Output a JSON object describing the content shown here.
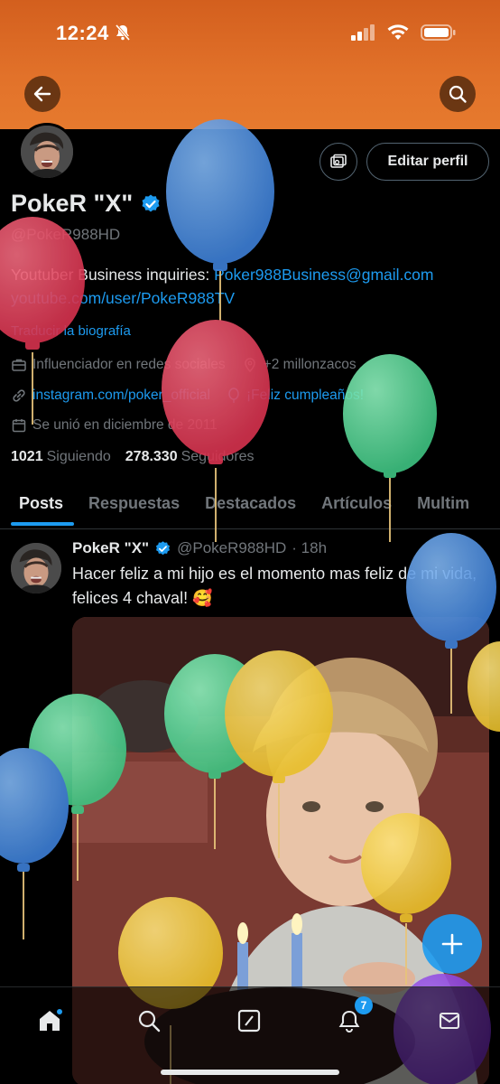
{
  "status_bar": {
    "time": "12:24",
    "bell_icon": "bell-slash-icon",
    "signal_icon": "cellular-signal-icon",
    "wifi_icon": "wifi-icon",
    "battery_icon": "battery-icon"
  },
  "header": {
    "back_icon": "arrow-left-icon",
    "search_icon": "search-icon",
    "banner_color": "#e2722a"
  },
  "profile": {
    "name": "PokeR \"X\"",
    "verified_icon": "verified-badge-icon",
    "handle": "@PokeR988HD",
    "edit_label": "Editar perfil",
    "bio_text": "Youtuber Business inquiries: ",
    "bio_email": "Poker988Business@gmail.com",
    "bio_url": "youtube.com/user/PokeR988TV",
    "translate": "Traducir la biografía",
    "category": "Influenciador en redes sociales",
    "location": "+2 millonzacos",
    "website": "instagram.com/poker_official",
    "birthday": "¡Feliz cumpleaños!",
    "joined": "Se unió en diciembre de 2011",
    "following_count": "1021",
    "following_label": "Siguiendo",
    "followers_count": "278.330",
    "followers_label": "Seguidores"
  },
  "tabs": [
    {
      "label": "Posts"
    },
    {
      "label": "Respuestas"
    },
    {
      "label": "Destacados"
    },
    {
      "label": "Artículos"
    },
    {
      "label": "Multim"
    }
  ],
  "tweet": {
    "name": "PokeR \"X\"",
    "handle": "@PokeR988HD",
    "time": "· 18h",
    "text": "Hacer feliz a mi hijo es el momento mas feliz de mi vida, felices 4 chaval! 🥰"
  },
  "bottom_nav": {
    "home_icon": "home-icon",
    "search_icon": "search-icon",
    "grok_icon": "grok-icon",
    "notifications_icon": "bell-icon",
    "notifications_badge": "7",
    "messages_icon": "mail-icon",
    "compose_icon": "plus-icon"
  },
  "colors": {
    "accent": "#1d9bf0",
    "background": "#000000",
    "text": "#e7e9ea",
    "muted": "#71767b"
  }
}
